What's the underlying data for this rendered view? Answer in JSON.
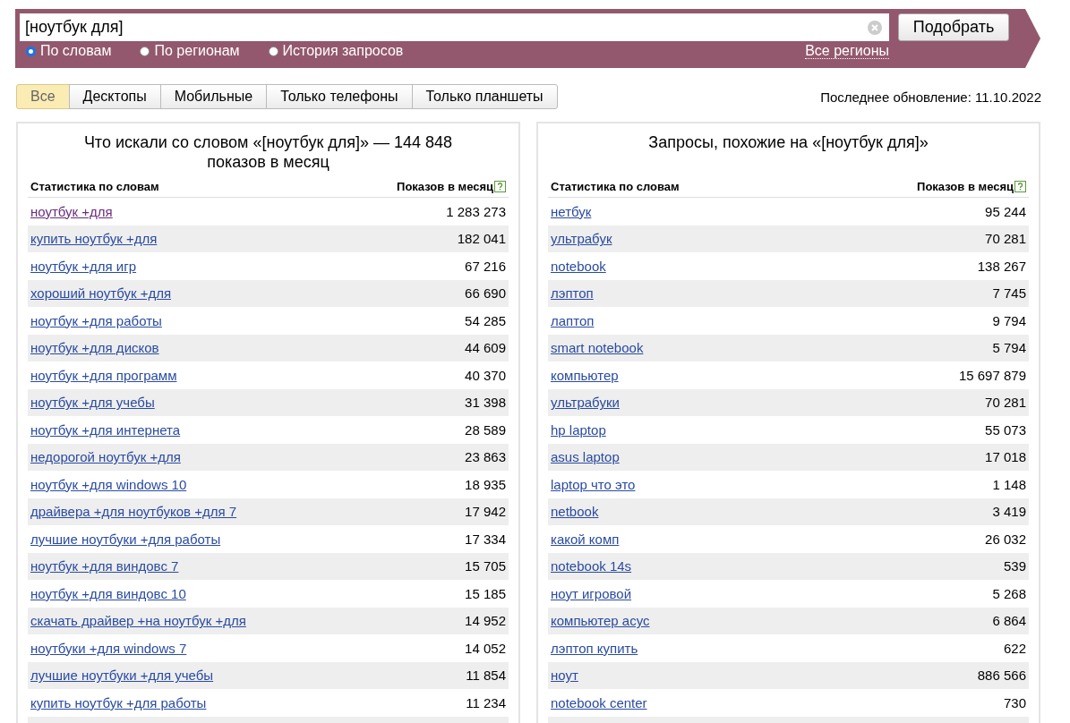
{
  "search": {
    "value": "[ноутбук для]",
    "button": "Подобрать"
  },
  "modes": [
    {
      "label": "По словам",
      "selected": true
    },
    {
      "label": "По регионам",
      "selected": false
    },
    {
      "label": "История запросов",
      "selected": false
    }
  ],
  "region_link": "Все регионы",
  "tabs": [
    {
      "label": "Все",
      "selected": true
    },
    {
      "label": "Десктопы",
      "selected": false
    },
    {
      "label": "Мобильные",
      "selected": false
    },
    {
      "label": "Только телефоны",
      "selected": false
    },
    {
      "label": "Только планшеты",
      "selected": false
    }
  ],
  "last_update": "Последнее обновление: 11.10.2022",
  "panels": [
    {
      "title": "Что искали со словом «[ноутбук для]» — 144 848 показов в месяц",
      "columns": [
        "Статистика по словам",
        "Показов в месяц"
      ],
      "rows": [
        {
          "phrase": "ноутбук +для",
          "count": "1 283 273",
          "visited": true
        },
        {
          "phrase": "купить ноутбук +для",
          "count": "182 041",
          "visited": false
        },
        {
          "phrase": "ноутбук +для игр",
          "count": "67 216",
          "visited": false
        },
        {
          "phrase": "хороший ноутбук +для",
          "count": "66 690",
          "visited": false
        },
        {
          "phrase": "ноутбук +для работы",
          "count": "54 285",
          "visited": false
        },
        {
          "phrase": "ноутбук +для дисков",
          "count": "44 609",
          "visited": false
        },
        {
          "phrase": "ноутбук +для программ",
          "count": "40 370",
          "visited": false
        },
        {
          "phrase": "ноутбук +для учебы",
          "count": "31 398",
          "visited": false
        },
        {
          "phrase": "ноутбук +для интернета",
          "count": "28 589",
          "visited": false
        },
        {
          "phrase": "недорогой ноутбук +для",
          "count": "23 863",
          "visited": false
        },
        {
          "phrase": "ноутбук +для windows 10",
          "count": "18 935",
          "visited": false
        },
        {
          "phrase": "драйвера +для ноутбуков +для 7",
          "count": "17 942",
          "visited": false
        },
        {
          "phrase": "лучшие ноутбуки +для работы",
          "count": "17 334",
          "visited": false
        },
        {
          "phrase": "ноутбук +для виндовс 7",
          "count": "15 705",
          "visited": false
        },
        {
          "phrase": "ноутбук +для виндовс 10",
          "count": "15 185",
          "visited": false
        },
        {
          "phrase": "скачать драйвер +на ноутбук +для",
          "count": "14 952",
          "visited": false
        },
        {
          "phrase": "ноутбуки +для windows 7",
          "count": "14 052",
          "visited": false
        },
        {
          "phrase": "лучшие ноутбуки +для учебы",
          "count": "11 854",
          "visited": false
        },
        {
          "phrase": "купить ноутбук +для работы",
          "count": "11 234",
          "visited": false
        }
      ]
    },
    {
      "title": "Запросы, похожие на «[ноутбук для]»",
      "columns": [
        "Статистика по словам",
        "Показов в месяц"
      ],
      "rows": [
        {
          "phrase": "нетбук",
          "count": "95 244",
          "visited": false
        },
        {
          "phrase": "ультрабук",
          "count": "70 281",
          "visited": false
        },
        {
          "phrase": "notebook",
          "count": "138 267",
          "visited": false
        },
        {
          "phrase": "лэптоп",
          "count": "7 745",
          "visited": false
        },
        {
          "phrase": "лаптоп",
          "count": "9 794",
          "visited": false
        },
        {
          "phrase": "smart notebook",
          "count": "5 794",
          "visited": false
        },
        {
          "phrase": "компьютер",
          "count": "15 697 879",
          "visited": false
        },
        {
          "phrase": "ультрабуки",
          "count": "70 281",
          "visited": false
        },
        {
          "phrase": "hp laptop",
          "count": "55 073",
          "visited": false
        },
        {
          "phrase": "asus laptop",
          "count": "17 018",
          "visited": false
        },
        {
          "phrase": "laptop что это",
          "count": "1 148",
          "visited": false
        },
        {
          "phrase": "netbook",
          "count": "3 419",
          "visited": false
        },
        {
          "phrase": "какой комп",
          "count": "26 032",
          "visited": false
        },
        {
          "phrase": "notebook 14s",
          "count": "539",
          "visited": false
        },
        {
          "phrase": "ноут игровой",
          "count": "5 268",
          "visited": false
        },
        {
          "phrase": "компьютер асус",
          "count": "6 864",
          "visited": false
        },
        {
          "phrase": "лэптоп купить",
          "count": "622",
          "visited": false
        },
        {
          "phrase": "ноут",
          "count": "886 566",
          "visited": false
        },
        {
          "phrase": "notebook center",
          "count": "730",
          "visited": false
        }
      ]
    }
  ]
}
